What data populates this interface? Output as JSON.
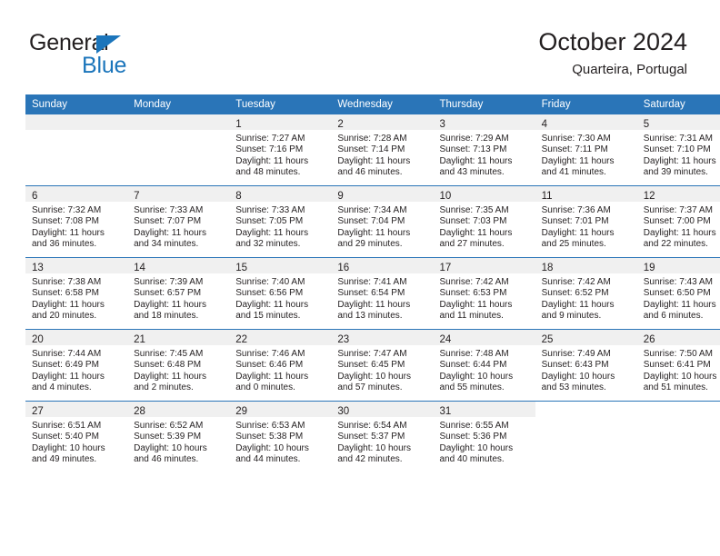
{
  "brand": {
    "line1": "General",
    "line2": "Blue",
    "triangle_color": "#1b75bb"
  },
  "header": {
    "title": "October 2024",
    "subtitle": "Quarteira, Portugal",
    "header_bg": "#2a75b8",
    "daynum_bg": "#f0f0f0"
  },
  "weekdays": [
    "Sunday",
    "Monday",
    "Tuesday",
    "Wednesday",
    "Thursday",
    "Friday",
    "Saturday"
  ],
  "labels": {
    "sunrise_prefix": "Sunrise: ",
    "sunset_prefix": "Sunset: ",
    "daylight_prefix": "Daylight: "
  },
  "weeks": [
    [
      {
        "empty": true
      },
      {
        "empty": true
      },
      {
        "day": "1",
        "sunrise": "Sunrise: 7:27 AM",
        "sunset": "Sunset: 7:16 PM",
        "daylight1": "Daylight: 11 hours",
        "daylight2": "and 48 minutes."
      },
      {
        "day": "2",
        "sunrise": "Sunrise: 7:28 AM",
        "sunset": "Sunset: 7:14 PM",
        "daylight1": "Daylight: 11 hours",
        "daylight2": "and 46 minutes."
      },
      {
        "day": "3",
        "sunrise": "Sunrise: 7:29 AM",
        "sunset": "Sunset: 7:13 PM",
        "daylight1": "Daylight: 11 hours",
        "daylight2": "and 43 minutes."
      },
      {
        "day": "4",
        "sunrise": "Sunrise: 7:30 AM",
        "sunset": "Sunset: 7:11 PM",
        "daylight1": "Daylight: 11 hours",
        "daylight2": "and 41 minutes."
      },
      {
        "day": "5",
        "sunrise": "Sunrise: 7:31 AM",
        "sunset": "Sunset: 7:10 PM",
        "daylight1": "Daylight: 11 hours",
        "daylight2": "and 39 minutes."
      }
    ],
    [
      {
        "day": "6",
        "sunrise": "Sunrise: 7:32 AM",
        "sunset": "Sunset: 7:08 PM",
        "daylight1": "Daylight: 11 hours",
        "daylight2": "and 36 minutes."
      },
      {
        "day": "7",
        "sunrise": "Sunrise: 7:33 AM",
        "sunset": "Sunset: 7:07 PM",
        "daylight1": "Daylight: 11 hours",
        "daylight2": "and 34 minutes."
      },
      {
        "day": "8",
        "sunrise": "Sunrise: 7:33 AM",
        "sunset": "Sunset: 7:05 PM",
        "daylight1": "Daylight: 11 hours",
        "daylight2": "and 32 minutes."
      },
      {
        "day": "9",
        "sunrise": "Sunrise: 7:34 AM",
        "sunset": "Sunset: 7:04 PM",
        "daylight1": "Daylight: 11 hours",
        "daylight2": "and 29 minutes."
      },
      {
        "day": "10",
        "sunrise": "Sunrise: 7:35 AM",
        "sunset": "Sunset: 7:03 PM",
        "daylight1": "Daylight: 11 hours",
        "daylight2": "and 27 minutes."
      },
      {
        "day": "11",
        "sunrise": "Sunrise: 7:36 AM",
        "sunset": "Sunset: 7:01 PM",
        "daylight1": "Daylight: 11 hours",
        "daylight2": "and 25 minutes."
      },
      {
        "day": "12",
        "sunrise": "Sunrise: 7:37 AM",
        "sunset": "Sunset: 7:00 PM",
        "daylight1": "Daylight: 11 hours",
        "daylight2": "and 22 minutes."
      }
    ],
    [
      {
        "day": "13",
        "sunrise": "Sunrise: 7:38 AM",
        "sunset": "Sunset: 6:58 PM",
        "daylight1": "Daylight: 11 hours",
        "daylight2": "and 20 minutes."
      },
      {
        "day": "14",
        "sunrise": "Sunrise: 7:39 AM",
        "sunset": "Sunset: 6:57 PM",
        "daylight1": "Daylight: 11 hours",
        "daylight2": "and 18 minutes."
      },
      {
        "day": "15",
        "sunrise": "Sunrise: 7:40 AM",
        "sunset": "Sunset: 6:56 PM",
        "daylight1": "Daylight: 11 hours",
        "daylight2": "and 15 minutes."
      },
      {
        "day": "16",
        "sunrise": "Sunrise: 7:41 AM",
        "sunset": "Sunset: 6:54 PM",
        "daylight1": "Daylight: 11 hours",
        "daylight2": "and 13 minutes."
      },
      {
        "day": "17",
        "sunrise": "Sunrise: 7:42 AM",
        "sunset": "Sunset: 6:53 PM",
        "daylight1": "Daylight: 11 hours",
        "daylight2": "and 11 minutes."
      },
      {
        "day": "18",
        "sunrise": "Sunrise: 7:42 AM",
        "sunset": "Sunset: 6:52 PM",
        "daylight1": "Daylight: 11 hours",
        "daylight2": "and 9 minutes."
      },
      {
        "day": "19",
        "sunrise": "Sunrise: 7:43 AM",
        "sunset": "Sunset: 6:50 PM",
        "daylight1": "Daylight: 11 hours",
        "daylight2": "and 6 minutes."
      }
    ],
    [
      {
        "day": "20",
        "sunrise": "Sunrise: 7:44 AM",
        "sunset": "Sunset: 6:49 PM",
        "daylight1": "Daylight: 11 hours",
        "daylight2": "and 4 minutes."
      },
      {
        "day": "21",
        "sunrise": "Sunrise: 7:45 AM",
        "sunset": "Sunset: 6:48 PM",
        "daylight1": "Daylight: 11 hours",
        "daylight2": "and 2 minutes."
      },
      {
        "day": "22",
        "sunrise": "Sunrise: 7:46 AM",
        "sunset": "Sunset: 6:46 PM",
        "daylight1": "Daylight: 11 hours",
        "daylight2": "and 0 minutes."
      },
      {
        "day": "23",
        "sunrise": "Sunrise: 7:47 AM",
        "sunset": "Sunset: 6:45 PM",
        "daylight1": "Daylight: 10 hours",
        "daylight2": "and 57 minutes."
      },
      {
        "day": "24",
        "sunrise": "Sunrise: 7:48 AM",
        "sunset": "Sunset: 6:44 PM",
        "daylight1": "Daylight: 10 hours",
        "daylight2": "and 55 minutes."
      },
      {
        "day": "25",
        "sunrise": "Sunrise: 7:49 AM",
        "sunset": "Sunset: 6:43 PM",
        "daylight1": "Daylight: 10 hours",
        "daylight2": "and 53 minutes."
      },
      {
        "day": "26",
        "sunrise": "Sunrise: 7:50 AM",
        "sunset": "Sunset: 6:41 PM",
        "daylight1": "Daylight: 10 hours",
        "daylight2": "and 51 minutes."
      }
    ],
    [
      {
        "day": "27",
        "sunrise": "Sunrise: 6:51 AM",
        "sunset": "Sunset: 5:40 PM",
        "daylight1": "Daylight: 10 hours",
        "daylight2": "and 49 minutes."
      },
      {
        "day": "28",
        "sunrise": "Sunrise: 6:52 AM",
        "sunset": "Sunset: 5:39 PM",
        "daylight1": "Daylight: 10 hours",
        "daylight2": "and 46 minutes."
      },
      {
        "day": "29",
        "sunrise": "Sunrise: 6:53 AM",
        "sunset": "Sunset: 5:38 PM",
        "daylight1": "Daylight: 10 hours",
        "daylight2": "and 44 minutes."
      },
      {
        "day": "30",
        "sunrise": "Sunrise: 6:54 AM",
        "sunset": "Sunset: 5:37 PM",
        "daylight1": "Daylight: 10 hours",
        "daylight2": "and 42 minutes."
      },
      {
        "day": "31",
        "sunrise": "Sunrise: 6:55 AM",
        "sunset": "Sunset: 5:36 PM",
        "daylight1": "Daylight: 10 hours",
        "daylight2": "and 40 minutes."
      },
      {
        "blank": true
      },
      {
        "blank": true
      }
    ]
  ]
}
